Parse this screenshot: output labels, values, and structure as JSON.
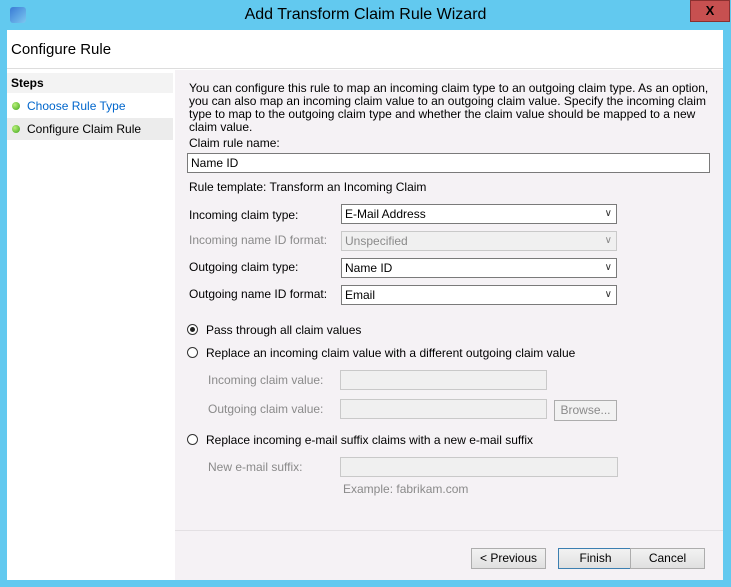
{
  "window": {
    "title": "Add Transform Claim Rule Wizard",
    "close": "X"
  },
  "header": {
    "title": "Configure Rule"
  },
  "steps": {
    "heading": "Steps",
    "items": [
      {
        "label": "Choose Rule Type"
      },
      {
        "label": "Configure Claim Rule"
      }
    ]
  },
  "main": {
    "description": "You can configure this rule to map an incoming claim type to an outgoing claim type. As an option, you can also map an incoming claim value to an outgoing claim value. Specify the incoming claim type to map to the outgoing claim type and whether the claim value should be mapped to a new claim value.",
    "rule_name_label": "Claim rule name:",
    "rule_name_value": "Name ID",
    "rule_template": "Rule template: Transform an Incoming Claim",
    "fields": [
      {
        "label": "Incoming claim type:",
        "value": "E-Mail Address"
      },
      {
        "label": "Incoming name ID format:",
        "value": "Unspecified"
      },
      {
        "label": "Outgoing claim type:",
        "value": "Name ID"
      },
      {
        "label": "Outgoing name ID format:",
        "value": "Email"
      }
    ],
    "options": [
      {
        "label": "Pass through all claim values",
        "selected": true
      },
      {
        "label": "Replace an incoming claim value with a different outgoing claim value",
        "selected": false
      },
      {
        "label": "Replace incoming e-mail suffix claims with a new e-mail suffix",
        "selected": false
      }
    ],
    "incoming_value_label": "Incoming claim value:",
    "outgoing_value_label": "Outgoing claim value:",
    "browse": "Browse...",
    "suffix_label": "New e-mail suffix:",
    "suffix_example": "Example: fabrikam.com"
  },
  "buttons": {
    "previous": "< Previous",
    "finish": "Finish",
    "cancel": "Cancel"
  }
}
